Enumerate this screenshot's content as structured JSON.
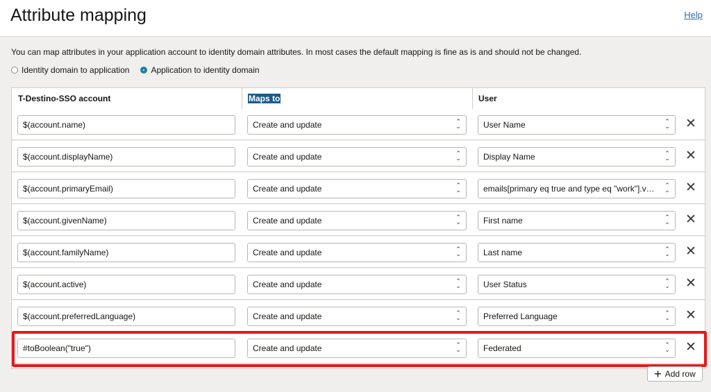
{
  "header": {
    "title": "Attribute mapping",
    "help_link": "Help"
  },
  "description": "You can map attributes in your application account to identity domain attributes. In most cases the default mapping is fine as is and should not be changed.",
  "direction": {
    "options": [
      {
        "label": "Identity domain to application",
        "selected": false
      },
      {
        "label": "Application to identity domain",
        "selected": true
      }
    ]
  },
  "table": {
    "columns": [
      "T-Destino-SSO account",
      "Maps to",
      "User"
    ],
    "rows": [
      {
        "source": "$(account.name)",
        "maps_to": "Create and update",
        "target": "User Name"
      },
      {
        "source": "$(account.displayName)",
        "maps_to": "Create and update",
        "target": "Display Name"
      },
      {
        "source": "$(account.primaryEmail)",
        "maps_to": "Create and update",
        "target": "emails[primary eq true and type eq \"work\"].va..."
      },
      {
        "source": "$(account.givenName)",
        "maps_to": "Create and update",
        "target": "First name"
      },
      {
        "source": "$(account.familyName)",
        "maps_to": "Create and update",
        "target": "Last name"
      },
      {
        "source": "$(account.active)",
        "maps_to": "Create and update",
        "target": "User Status"
      },
      {
        "source": "$(account.preferredLanguage)",
        "maps_to": "Create and update",
        "target": "Preferred Language"
      },
      {
        "source": "#toBoolean(\"true\")",
        "maps_to": "Create and update",
        "target": "Federated"
      }
    ]
  },
  "add_row_label": "Add row",
  "colors": {
    "accent": "#227e9e",
    "highlight": "#e51919",
    "selected_header": "#1e5b88"
  }
}
